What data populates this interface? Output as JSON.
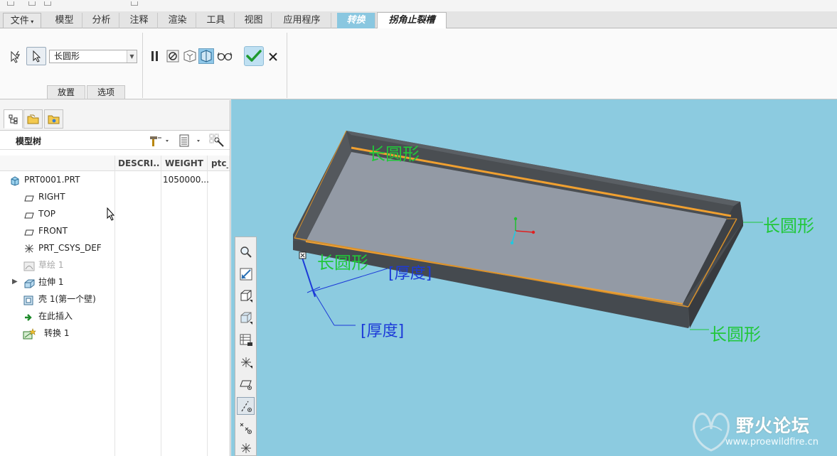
{
  "ribbon_tabs": {
    "file": "文件",
    "model": "模型",
    "analysis": "分析",
    "annotate": "注释",
    "render": "渲染",
    "tools": "工具",
    "view": "视图",
    "apps": "应用程序",
    "convert": "转换",
    "active": "拐角止裂槽"
  },
  "ribbon": {
    "relief_type_value": "长圆形",
    "subtab_placement": "放置",
    "subtab_options": "选项"
  },
  "panel": {
    "tree_title": "模型树",
    "columns": [
      "DESCRI...",
      "WEIGHT",
      "ptc_"
    ]
  },
  "tree": {
    "root_label": "PRT0001.PRT",
    "root_weight": "1050000...",
    "items": [
      {
        "label": "RIGHT",
        "icon": "datum-plane-icon"
      },
      {
        "label": "TOP",
        "icon": "datum-plane-icon"
      },
      {
        "label": "FRONT",
        "icon": "datum-plane-icon"
      },
      {
        "label": "PRT_CSYS_DEF",
        "icon": "csys-icon"
      },
      {
        "label": "草绘 1",
        "icon": "sketch-icon"
      },
      {
        "label": "拉伸 1",
        "icon": "extrude-icon"
      },
      {
        "label": "壳 1(第一个壁)",
        "icon": "shell-icon"
      },
      {
        "label": "在此插入",
        "icon": "insert-here-icon"
      },
      {
        "label": "转换 1",
        "icon": "convert-icon"
      }
    ]
  },
  "viewport": {
    "label_obround": "长圆形",
    "label_thickness": "[厚度]"
  },
  "watermark": {
    "title": "野火论坛",
    "url": "www.proewildfire.cn"
  },
  "colors": {
    "viewport_bg": "#8ccbe0",
    "annotation_green": "#21c73a",
    "dimension_blue": "#1c3ad8",
    "part_edge_orange": "#f0a030"
  }
}
